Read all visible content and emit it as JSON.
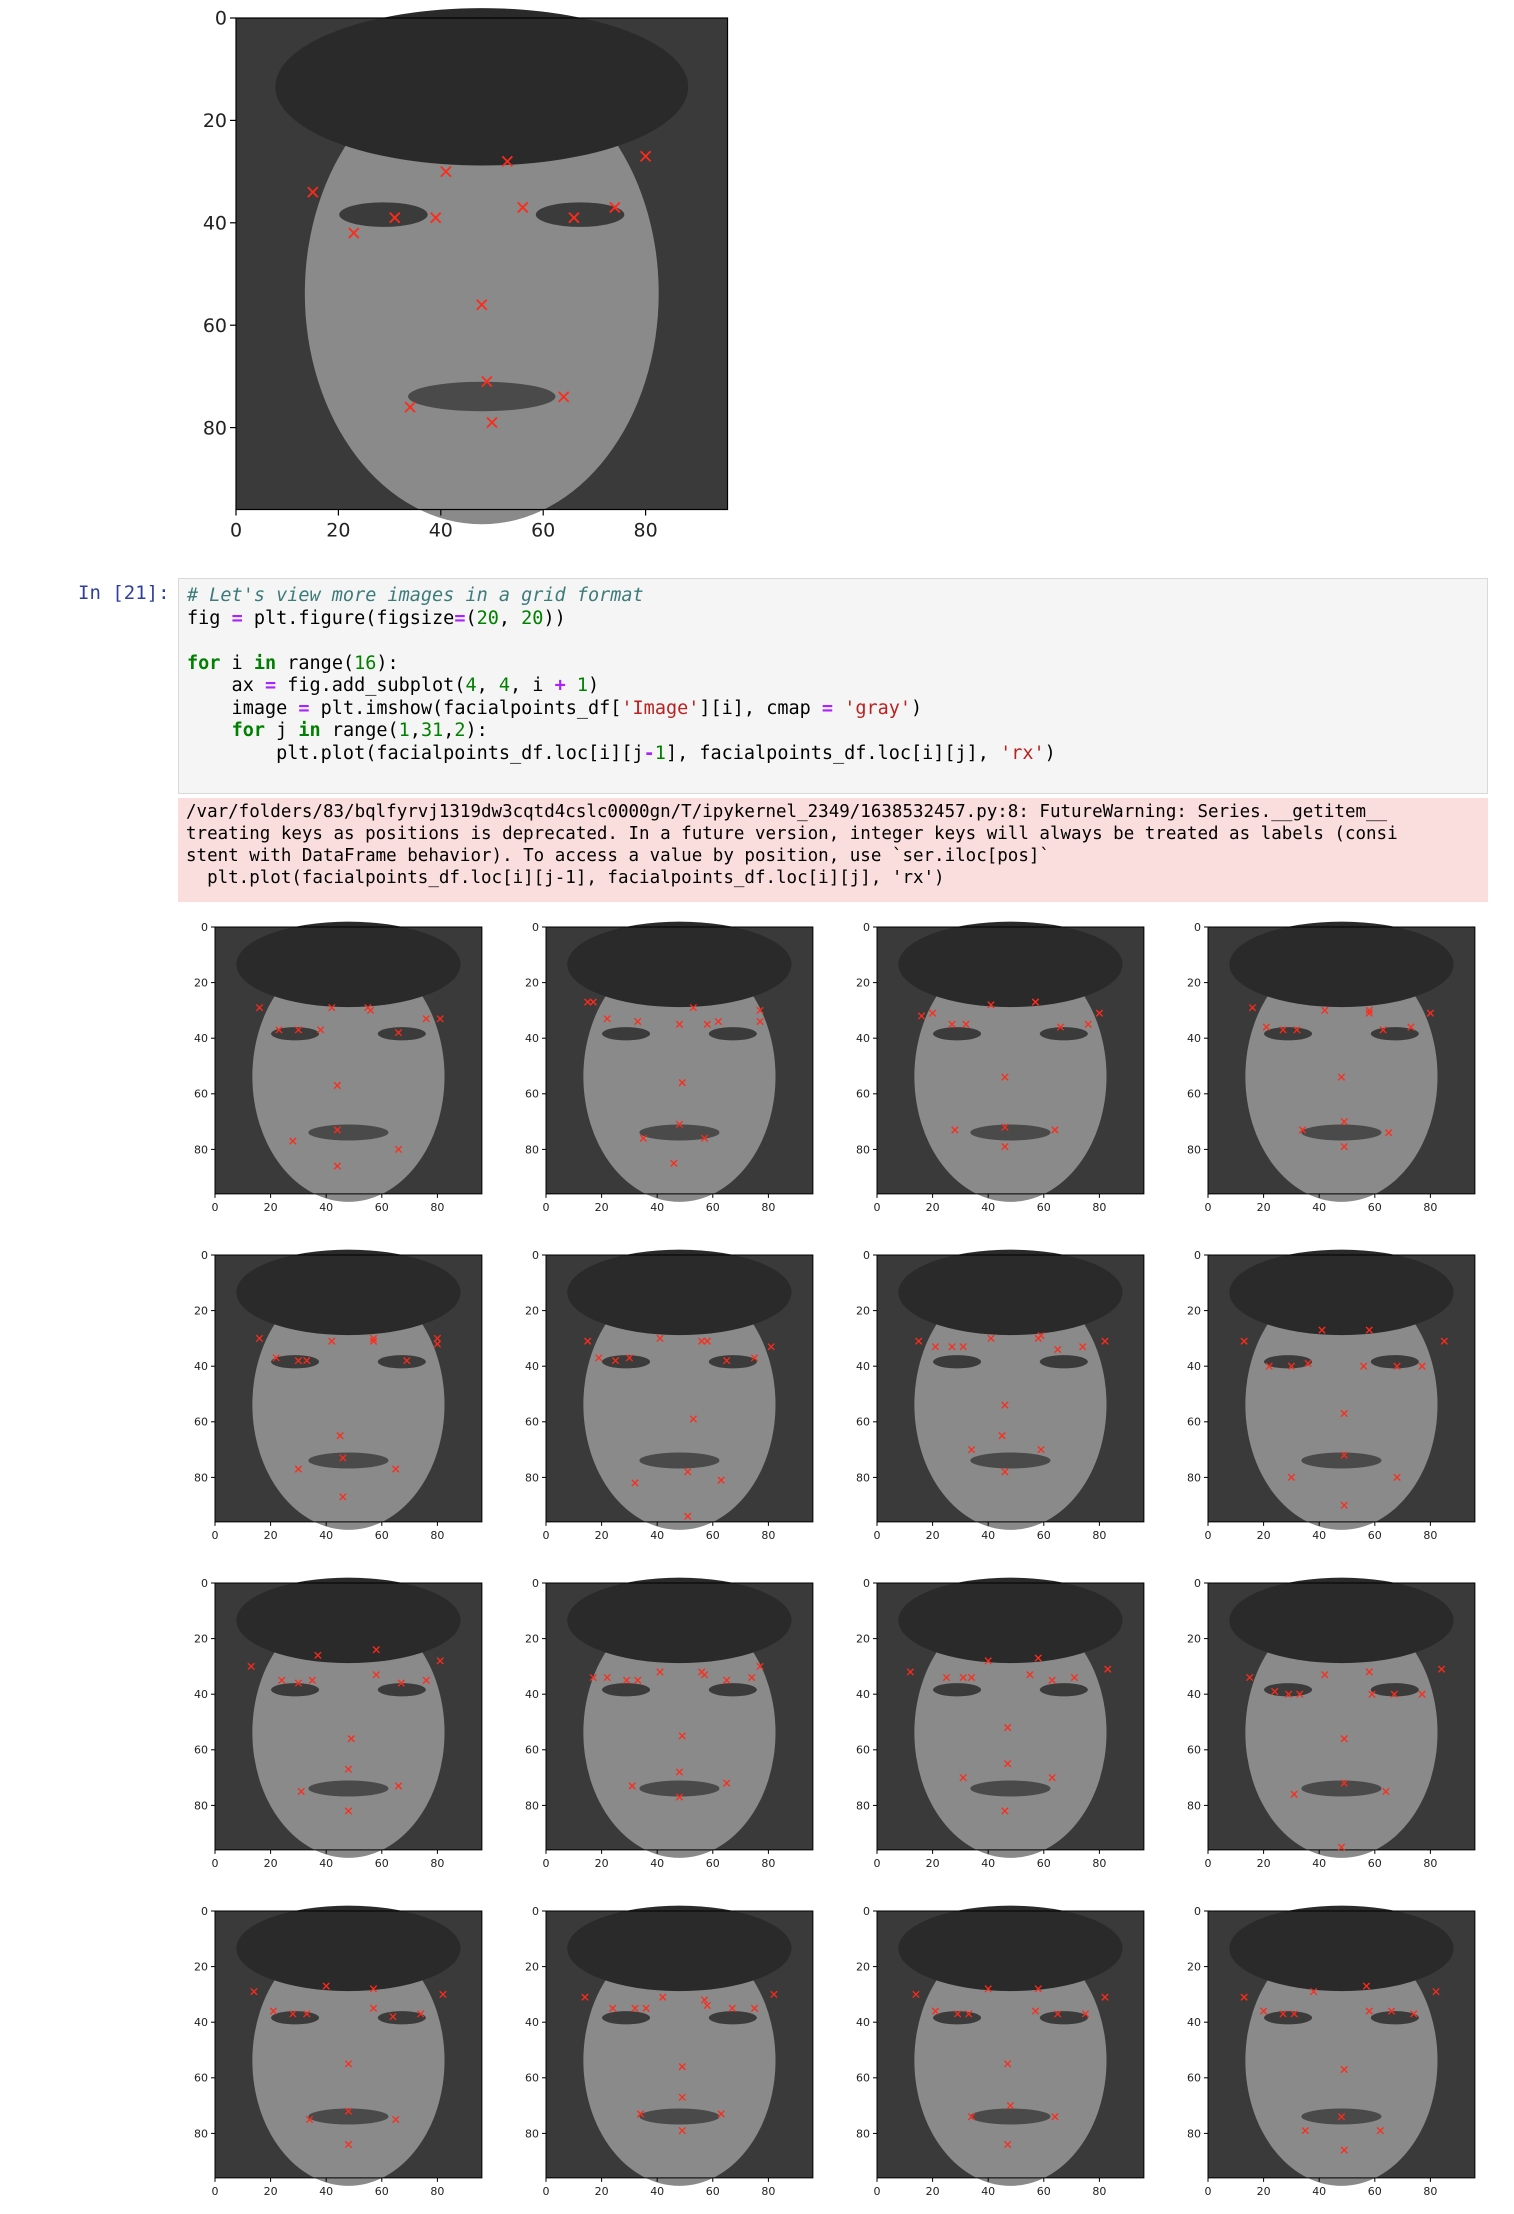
{
  "main_plot": {
    "x_ticks": [
      "0",
      "20",
      "40",
      "60",
      "80"
    ],
    "y_ticks": [
      "0",
      "20",
      "40",
      "60",
      "80"
    ],
    "keypoints": [
      [
        66,
        39
      ],
      [
        39,
        39
      ],
      [
        74,
        37
      ],
      [
        56,
        37
      ],
      [
        31,
        39
      ],
      [
        23,
        42
      ],
      [
        80,
        27
      ],
      [
        53,
        28
      ],
      [
        41,
        30
      ],
      [
        15,
        34
      ],
      [
        48,
        56
      ],
      [
        64,
        74
      ],
      [
        34,
        76
      ],
      [
        49,
        71
      ],
      [
        50,
        79
      ]
    ]
  },
  "cell": {
    "prompt": "In [21]:",
    "code_lines": [
      "# Let's view more images in a grid format",
      "fig = plt.figure(figsize=(20, 20))",
      "",
      "for i in range(16):",
      "    ax = fig.add_subplot(4, 4, i + 1)",
      "    image = plt.imshow(facialpoints_df['Image'][i], cmap = 'gray')",
      "    for j in range(1,31,2):",
      "        plt.plot(facialpoints_df.loc[i][j-1], facialpoints_df.loc[i][j], 'rx')"
    ]
  },
  "stderr": {
    "lines": [
      "/var/folders/83/bqlfyrvj1319dw3cqtd4cslc0000gn/T/ipykernel_2349/1638532457.py:8: FutureWarning: Series.__getitem__",
      "treating keys as positions is deprecated. In a future version, integer keys will always be treated as labels (consi",
      "stent with DataFrame behavior). To access a value by position, use `ser.iloc[pos]`",
      "  plt.plot(facialpoints_df.loc[i][j-1], facialpoints_df.loc[i][j], 'rx')"
    ]
  },
  "grid": {
    "x_ticks": [
      "0",
      "20",
      "40",
      "60",
      "80"
    ],
    "y_ticks": [
      "0",
      "20",
      "40",
      "60",
      "80"
    ],
    "faces": [
      [
        [
          66,
          38
        ],
        [
          38,
          37
        ],
        [
          76,
          33
        ],
        [
          55,
          29
        ],
        [
          30,
          37
        ],
        [
          23,
          37
        ],
        [
          81,
          33
        ],
        [
          56,
          30
        ],
        [
          42,
          29
        ],
        [
          16,
          29
        ],
        [
          44,
          57
        ],
        [
          66,
          80
        ],
        [
          28,
          77
        ],
        [
          44,
          73
        ],
        [
          44,
          86
        ]
      ],
      [
        [
          62,
          34
        ],
        [
          33,
          34
        ],
        [
          77,
          30
        ],
        [
          53,
          29
        ],
        [
          22,
          33
        ],
        [
          15,
          27
        ],
        [
          77,
          34
        ],
        [
          58,
          35
        ],
        [
          48,
          35
        ],
        [
          17,
          27
        ],
        [
          49,
          56
        ],
        [
          57,
          76
        ],
        [
          35,
          76
        ],
        [
          48,
          71
        ],
        [
          46,
          85
        ]
      ],
      [
        [
          66,
          36
        ],
        [
          32,
          35
        ],
        [
          76,
          35
        ],
        [
          57,
          27
        ],
        [
          27,
          35
        ],
        [
          20,
          31
        ],
        [
          80,
          31
        ],
        [
          57,
          27
        ],
        [
          41,
          28
        ],
        [
          16,
          32
        ],
        [
          46,
          54
        ],
        [
          64,
          73
        ],
        [
          28,
          73
        ],
        [
          46,
          72
        ],
        [
          46,
          79
        ]
      ],
      [
        [
          63,
          37
        ],
        [
          32,
          37
        ],
        [
          73,
          36
        ],
        [
          58,
          31
        ],
        [
          27,
          37
        ],
        [
          21,
          36
        ],
        [
          80,
          31
        ],
        [
          58,
          30
        ],
        [
          42,
          30
        ],
        [
          16,
          29
        ],
        [
          48,
          54
        ],
        [
          65,
          74
        ],
        [
          34,
          73
        ],
        [
          49,
          70
        ],
        [
          49,
          79
        ]
      ],
      [
        [
          69,
          38
        ],
        [
          33,
          38
        ],
        [
          80,
          30
        ],
        [
          57,
          31
        ],
        [
          30,
          38
        ],
        [
          22,
          37
        ],
        [
          80,
          32
        ],
        [
          57,
          30
        ],
        [
          42,
          31
        ],
        [
          16,
          30
        ],
        [
          45,
          65
        ],
        [
          65,
          77
        ],
        [
          30,
          77
        ],
        [
          46,
          73
        ],
        [
          46,
          87
        ]
      ],
      [
        [
          65,
          38
        ],
        [
          30,
          37
        ],
        [
          75,
          37
        ],
        [
          58,
          31
        ],
        [
          25,
          38
        ],
        [
          19,
          37
        ],
        [
          81,
          33
        ],
        [
          56,
          31
        ],
        [
          41,
          30
        ],
        [
          15,
          31
        ],
        [
          53,
          59
        ],
        [
          63,
          81
        ],
        [
          32,
          82
        ],
        [
          51,
          78
        ],
        [
          51,
          94
        ]
      ],
      [
        [
          65,
          34
        ],
        [
          31,
          33
        ],
        [
          74,
          33
        ],
        [
          59,
          29
        ],
        [
          27,
          33
        ],
        [
          21,
          33
        ],
        [
          82,
          31
        ],
        [
          58,
          30
        ],
        [
          41,
          30
        ],
        [
          15,
          31
        ],
        [
          46,
          54
        ],
        [
          59,
          70
        ],
        [
          34,
          70
        ],
        [
          45,
          65
        ],
        [
          46,
          78
        ]
      ],
      [
        [
          68,
          40
        ],
        [
          36,
          39
        ],
        [
          77,
          40
        ],
        [
          56,
          40
        ],
        [
          30,
          40
        ],
        [
          22,
          40
        ],
        [
          85,
          31
        ],
        [
          58,
          27
        ],
        [
          41,
          27
        ],
        [
          13,
          31
        ],
        [
          49,
          57
        ],
        [
          68,
          80
        ],
        [
          30,
          80
        ],
        [
          49,
          72
        ],
        [
          49,
          90
        ]
      ],
      [
        [
          67,
          36
        ],
        [
          35,
          35
        ],
        [
          76,
          35
        ],
        [
          58,
          33
        ],
        [
          30,
          36
        ],
        [
          24,
          35
        ],
        [
          81,
          28
        ],
        [
          58,
          24
        ],
        [
          37,
          26
        ],
        [
          13,
          30
        ],
        [
          49,
          56
        ],
        [
          66,
          73
        ],
        [
          31,
          75
        ],
        [
          48,
          67
        ],
        [
          48,
          82
        ]
      ],
      [
        [
          65,
          35
        ],
        [
          33,
          35
        ],
        [
          74,
          34
        ],
        [
          57,
          33
        ],
        [
          29,
          35
        ],
        [
          22,
          34
        ],
        [
          77,
          30
        ],
        [
          56,
          32
        ],
        [
          41,
          32
        ],
        [
          17,
          34
        ],
        [
          49,
          55
        ],
        [
          65,
          72
        ],
        [
          31,
          73
        ],
        [
          48,
          68
        ],
        [
          48,
          77
        ]
      ],
      [
        [
          63,
          35
        ],
        [
          34,
          34
        ],
        [
          71,
          34
        ],
        [
          55,
          33
        ],
        [
          31,
          34
        ],
        [
          25,
          34
        ],
        [
          83,
          31
        ],
        [
          58,
          27
        ],
        [
          40,
          28
        ],
        [
          12,
          32
        ],
        [
          47,
          52
        ],
        [
          63,
          70
        ],
        [
          31,
          70
        ],
        [
          47,
          65
        ],
        [
          46,
          82
        ]
      ],
      [
        [
          67,
          40
        ],
        [
          33,
          40
        ],
        [
          77,
          40
        ],
        [
          59,
          40
        ],
        [
          29,
          40
        ],
        [
          24,
          39
        ],
        [
          84,
          31
        ],
        [
          58,
          32
        ],
        [
          42,
          33
        ],
        [
          15,
          34
        ],
        [
          49,
          56
        ],
        [
          64,
          75
        ],
        [
          31,
          76
        ],
        [
          49,
          72
        ],
        [
          48,
          95
        ]
      ],
      [
        [
          64,
          38
        ],
        [
          33,
          37
        ],
        [
          74,
          37
        ],
        [
          57,
          35
        ],
        [
          28,
          37
        ],
        [
          21,
          36
        ],
        [
          82,
          30
        ],
        [
          57,
          28
        ],
        [
          40,
          27
        ],
        [
          14,
          29
        ],
        [
          48,
          55
        ],
        [
          65,
          75
        ],
        [
          34,
          75
        ],
        [
          48,
          72
        ],
        [
          48,
          84
        ]
      ],
      [
        [
          67,
          35
        ],
        [
          36,
          35
        ],
        [
          75,
          35
        ],
        [
          58,
          34
        ],
        [
          32,
          35
        ],
        [
          24,
          35
        ],
        [
          82,
          30
        ],
        [
          57,
          32
        ],
        [
          42,
          31
        ],
        [
          14,
          31
        ],
        [
          49,
          56
        ],
        [
          63,
          73
        ],
        [
          34,
          73
        ],
        [
          49,
          67
        ],
        [
          49,
          79
        ]
      ],
      [
        [
          65,
          37
        ],
        [
          33,
          37
        ],
        [
          75,
          37
        ],
        [
          57,
          36
        ],
        [
          29,
          37
        ],
        [
          21,
          36
        ],
        [
          82,
          31
        ],
        [
          58,
          28
        ],
        [
          40,
          28
        ],
        [
          14,
          30
        ],
        [
          47,
          55
        ],
        [
          64,
          74
        ],
        [
          34,
          74
        ],
        [
          48,
          70
        ],
        [
          47,
          84
        ]
      ],
      [
        [
          66,
          36
        ],
        [
          31,
          37
        ],
        [
          74,
          37
        ],
        [
          58,
          36
        ],
        [
          27,
          37
        ],
        [
          20,
          36
        ],
        [
          82,
          29
        ],
        [
          57,
          27
        ],
        [
          38,
          29
        ],
        [
          13,
          31
        ],
        [
          49,
          57
        ],
        [
          62,
          79
        ],
        [
          35,
          79
        ],
        [
          48,
          74
        ],
        [
          49,
          86
        ]
      ]
    ]
  }
}
